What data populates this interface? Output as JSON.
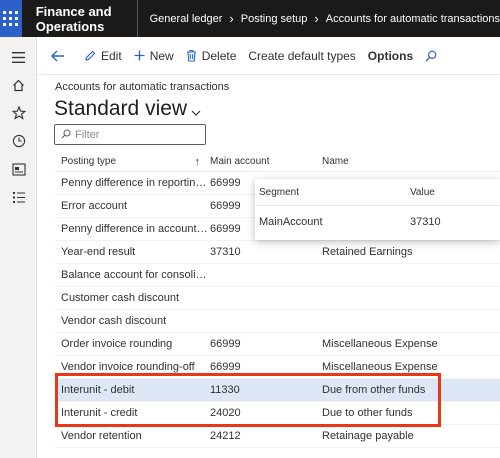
{
  "app": {
    "title": "Finance and Operations",
    "breadcrumb": [
      "General ledger",
      "Posting setup",
      "Accounts for automatic transactions"
    ]
  },
  "nav_rail": {
    "icons": [
      "hamburger-icon",
      "home-icon",
      "star-icon",
      "clock-icon",
      "workspace-icon",
      "list-icon"
    ]
  },
  "actions": {
    "edit": "Edit",
    "new": "New",
    "delete": "Delete",
    "create_defaults": "Create default types",
    "options": "Options"
  },
  "page": {
    "subtitle": "Accounts for automatic transactions",
    "view_name": "Standard view",
    "filter_placeholder": "Filter"
  },
  "grid": {
    "headers": {
      "posting_type": "Posting type",
      "main_account": "Main account",
      "name": "Name"
    },
    "rows": [
      {
        "posting_type": "Penny difference in reporting c...",
        "main_account": "66999",
        "name": ""
      },
      {
        "posting_type": "Error account",
        "main_account": "66999",
        "name": ""
      },
      {
        "posting_type": "Penny difference in accounting ...",
        "main_account": "66999",
        "name": ""
      },
      {
        "posting_type": "Year-end result",
        "main_account": "37310",
        "name": "Retained Earnings"
      },
      {
        "posting_type": "Balance account for consolidati...",
        "main_account": "",
        "name": ""
      },
      {
        "posting_type": "Customer cash discount",
        "main_account": "",
        "name": ""
      },
      {
        "posting_type": "Vendor cash discount",
        "main_account": "",
        "name": ""
      },
      {
        "posting_type": "Order invoice rounding",
        "main_account": "66999",
        "name": "Miscellaneous Expense"
      },
      {
        "posting_type": "Vendor invoice rounding-off",
        "main_account": "66999",
        "name": "Miscellaneous Expense"
      },
      {
        "posting_type": "Interunit - debit",
        "main_account": "11330",
        "name": "Due from other funds",
        "selected": true
      },
      {
        "posting_type": "Interunit - credit",
        "main_account": "24020",
        "name": "Due to other funds"
      },
      {
        "posting_type": "Vendor retention",
        "main_account": "24212",
        "name": "Retainage payable"
      }
    ]
  },
  "segment_popup": {
    "headers": {
      "segment": "Segment",
      "value": "Value"
    },
    "segment": "MainAccount",
    "value": "37310"
  },
  "colors": {
    "accent": "#2b61c9",
    "topbar": "#1b1a19",
    "selected_row": "#dde7f6",
    "highlight_box": "#e63a17"
  }
}
